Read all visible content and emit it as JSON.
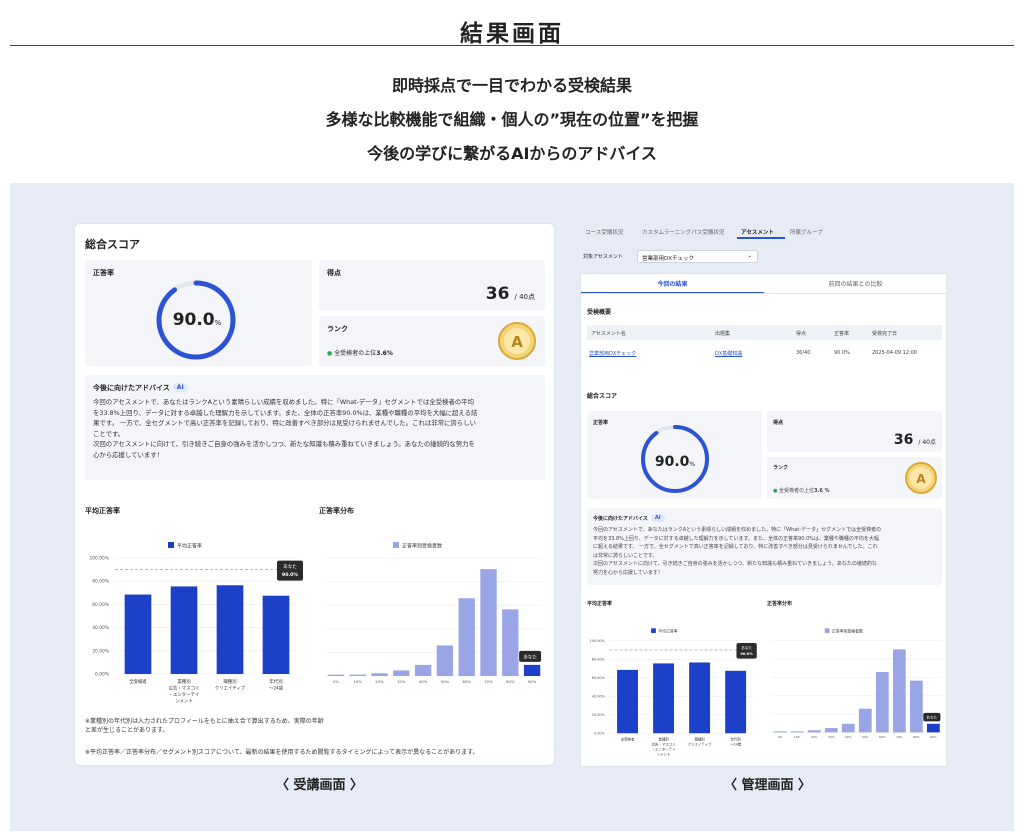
{
  "header": {
    "title": "結果画面",
    "tagline1": "即時採点で一目でわかる受検結果",
    "tagline2": "多様な比較機能で組織・個人の”現在の位置”を把握",
    "tagline3": "今後の学びに繋がるAIからのアドバイス"
  },
  "captions": {
    "learner": "〈 受講画面 〉",
    "admin": "〈 管理画面 〉"
  },
  "learner": {
    "overall_title": "総合スコア",
    "accuracy_label": "正答率",
    "accuracy_value": "90.0",
    "accuracy_unit": "%",
    "accuracy_fraction": 0.9,
    "score_label": "得点",
    "score_value": "36",
    "score_total": "/ 40点",
    "rank_label": "ランク",
    "rank_text": "全受検者の上位",
    "rank_pct": "3.6%",
    "rank_grade": "A",
    "advice_title": "今後に向けたアドバイス",
    "ai_badge": "AI",
    "advice_lines": [
      "今回のアセスメントで、あなたはランクAという素晴らしい成績を収めました。特に「What-データ」セグメントでは全受検者の平均",
      "を33.8%上回り、データに対する卓越した理解力を示しています。また、全体の正答率90.0%は、業種や職種の平均を大幅に超える結",
      "果です。 一方で、全セグメントで高い正答率を記録しており、特に改善すべき部分は見受けられませんでした。これは非常に誇らしい",
      "ことです。",
      "次回のアセスメントに向けて、引き続きご自身の強みを活かしつつ、新たな知識も積み重ねていきましょう。あなたの継続的な努力を",
      "心から応援しています！"
    ],
    "avg_title": "平均正答率",
    "dist_title": "正答率分布",
    "note1": "※業種別の年代別は入力されたプロフィールをもとに抽え合で算出するため、実際の年齢",
    "note1b": "と差が生じることがあります。",
    "note2": "※平均正答率／正答率分布／セグメント別スコアについて、最新の結果を使用するため閲覧するタイミングによって表示が異なることがあります。"
  },
  "admin": {
    "tabs": [
      "コース受講状況",
      "カスタムラーニングパス受講状況",
      "アセスメント",
      "所属グループ"
    ],
    "active_tab": "アセスメント",
    "filter_label": "対象アセスメント",
    "filter_value": "営業部用DXチェック",
    "subtab_current": "今回の結果",
    "subtab_compare": "前回の結果との比較",
    "summary_title": "受検概要",
    "table_headers": [
      "アセスメント名",
      "出題集",
      "得点",
      "正答率",
      "受検完了日"
    ],
    "table_row": [
      "営業部用DXチェック",
      "DX基礎知識",
      "36/40",
      "90.0%",
      "2025-04-09 12:00"
    ],
    "overall_title": "総合スコア",
    "accuracy_label": "正答率",
    "accuracy_value": "90.0",
    "accuracy_unit": "%",
    "score_label": "得点",
    "score_value": "36",
    "score_total": "/ 40点",
    "rank_label": "ランク",
    "rank_text": "全受検者の上位",
    "rank_pct": "3.6 %",
    "advice_title": "今後に向けたアドバイス",
    "advice_lines": [
      "今回のアセスメントで、あなたはランクAという素晴らしい成績を収めました。特に「What-データ」セグメントでは全受検者の",
      "平均を33.8%上回り、データに対する卓越した理解力を示しています。また、全体の正答率90.0%は、業種や職種の平均を大幅",
      "に超える結果です。 一方で、全セグメントで高い正答率を記録しており、特に改善すべき部分は見受けられませんでした。これ",
      "は非常に誇らしいことです。",
      "次回のアセスメントに向けて、引き続きご自身の強みを活かしつつ、新たな知識も積み重ねていきましょう。あなたの継続的な",
      "努力を心から応援しています！"
    ],
    "avg_title": "平均正答率",
    "dist_title": "正答率分布"
  },
  "chart_data": [
    {
      "type": "bar",
      "title": "平均正答率",
      "legend": "平均正答率",
      "categories": [
        "全受検者",
        "業種別\n広告・マスコミ・エンターテインメント",
        "職種別\nクリエイティブ",
        "年代別\n～24歳"
      ],
      "values": [
        68.5,
        75.5,
        76.5,
        67.5
      ],
      "yticks": [
        "0.00%",
        "20.00%",
        "40.00%",
        "60.00%",
        "80.00%",
        "100.00%"
      ],
      "ylim": [
        0,
        100
      ],
      "reference_label": "あなた",
      "reference_value": 90.0,
      "reference_text": "90.0%"
    },
    {
      "type": "bar",
      "title": "正答率分布",
      "legend": "正答率別受検者数",
      "categories": [
        "0%",
        "10%",
        "20%",
        "30%",
        "40%",
        "50%",
        "60%",
        "70%",
        "80%",
        "90%"
      ],
      "values": [
        1,
        1,
        2,
        4,
        8,
        22,
        56,
        77,
        48,
        8
      ],
      "highlight_index": 9,
      "highlight_label": "あなた",
      "ylim": [
        0,
        85
      ]
    }
  ]
}
